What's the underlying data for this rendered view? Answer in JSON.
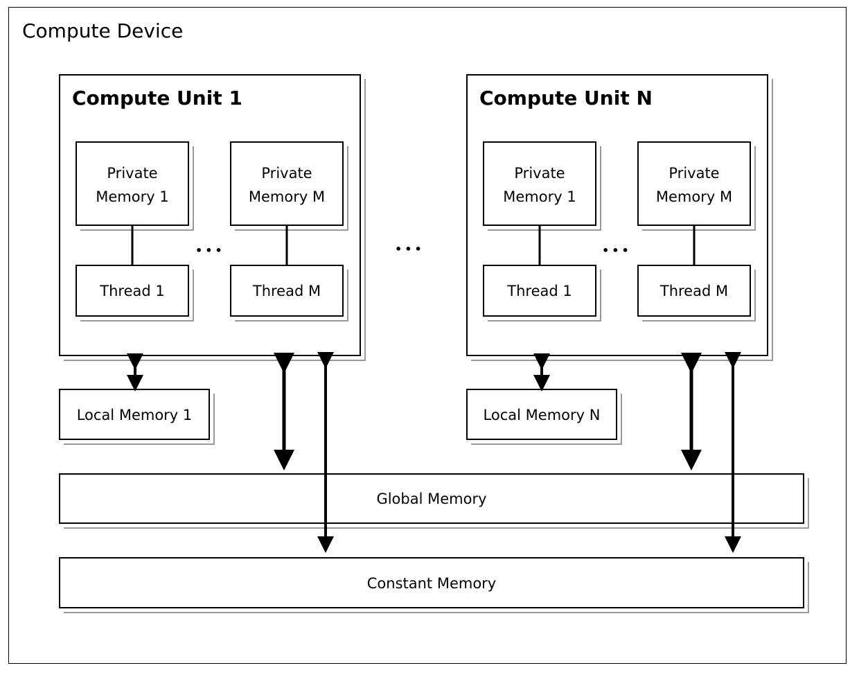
{
  "device": {
    "title": "Compute Device"
  },
  "units": [
    {
      "title": "Compute Unit 1",
      "private_memories": [
        "Private Memory 1",
        "Private Memory M"
      ],
      "threads": [
        "Thread 1",
        "Thread M"
      ],
      "local_memory": "Local Memory 1"
    },
    {
      "title": "Compute Unit N",
      "private_memories": [
        "Private Memory 1",
        "Private Memory M"
      ],
      "threads": [
        "Thread 1",
        "Thread M"
      ],
      "local_memory": "Local Memory N"
    }
  ],
  "ellipsis": "•••",
  "global_memory": "Global Memory",
  "constant_memory": "Constant Memory"
}
